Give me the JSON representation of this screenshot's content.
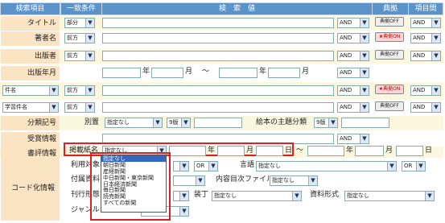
{
  "headers": {
    "item": "検索項目",
    "match": "一致条件",
    "value": "検　索　値",
    "code": "典拠",
    "field": "項目間"
  },
  "labels": {
    "title": "タイトル",
    "author": "著者名",
    "publisher": "出版者",
    "year": "出版年月",
    "class": "分類記号",
    "award": "受賞情報",
    "review": "書評情報",
    "code": "コード化情報"
  },
  "selects": {
    "partial": "部分",
    "prefix": "前方",
    "and": "AND",
    "or": "OR",
    "none": "指定なし",
    "hakkan": "9版",
    "book_title": "件名",
    "subject": "学習件名"
  },
  "buttons": {
    "off": "典拠OFF",
    "on": "★典拠ON"
  },
  "units": {
    "year": "年",
    "month": "月",
    "day": "日",
    "tilde": "〜"
  },
  "class_row": {
    "betsu": "別置",
    "picture": "絵本の主題分類"
  },
  "review_row": {
    "paper": "掲載紙名"
  },
  "code_row": {
    "target": "利用対象",
    "lang": "言語",
    "attach": "付属資料",
    "contents": "内容目次ファイル",
    "form": "刊行形態",
    "binding": "装丁",
    "material": "資料形式",
    "genre": "ジャンル"
  },
  "dropdown": {
    "options": [
      "指定なし",
      "朝日新聞",
      "産経新聞",
      "中日新聞・東京新聞",
      "日本経済新聞",
      "毎日新聞",
      "読売新聞",
      "すべての新聞"
    ],
    "selected_index": 0
  }
}
